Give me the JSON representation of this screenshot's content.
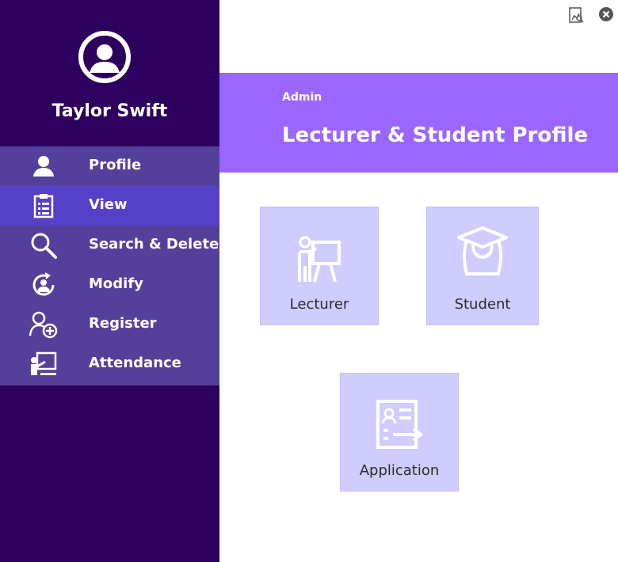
{
  "user": {
    "name": "Taylor Swift"
  },
  "menu": {
    "items": [
      {
        "label": "Profile",
        "icon": "user-icon"
      },
      {
        "label": "View",
        "icon": "clipboard-list-icon",
        "active": true
      },
      {
        "label": "Search & Delete",
        "icon": "search-icon"
      },
      {
        "label": "Modify",
        "icon": "refresh-user-icon"
      },
      {
        "label": "Register",
        "icon": "add-user-icon"
      },
      {
        "label": "Attendance",
        "icon": "presentation-board-icon"
      }
    ]
  },
  "header": {
    "subtitle": "Admin",
    "title": "Lecturer & Student Profile"
  },
  "tiles": {
    "lecturer": {
      "label": "Lecturer",
      "icon": "teacher-board-icon"
    },
    "student": {
      "label": "Student",
      "icon": "graduate-student-icon"
    },
    "application": {
      "label": "Application",
      "icon": "id-document-icon"
    }
  },
  "colors": {
    "sidebar": "#2e005e",
    "menu_bg": "#54409a",
    "menu_active": "#5541c8",
    "header": "#9b66ff",
    "tile": "#cfccfe"
  }
}
